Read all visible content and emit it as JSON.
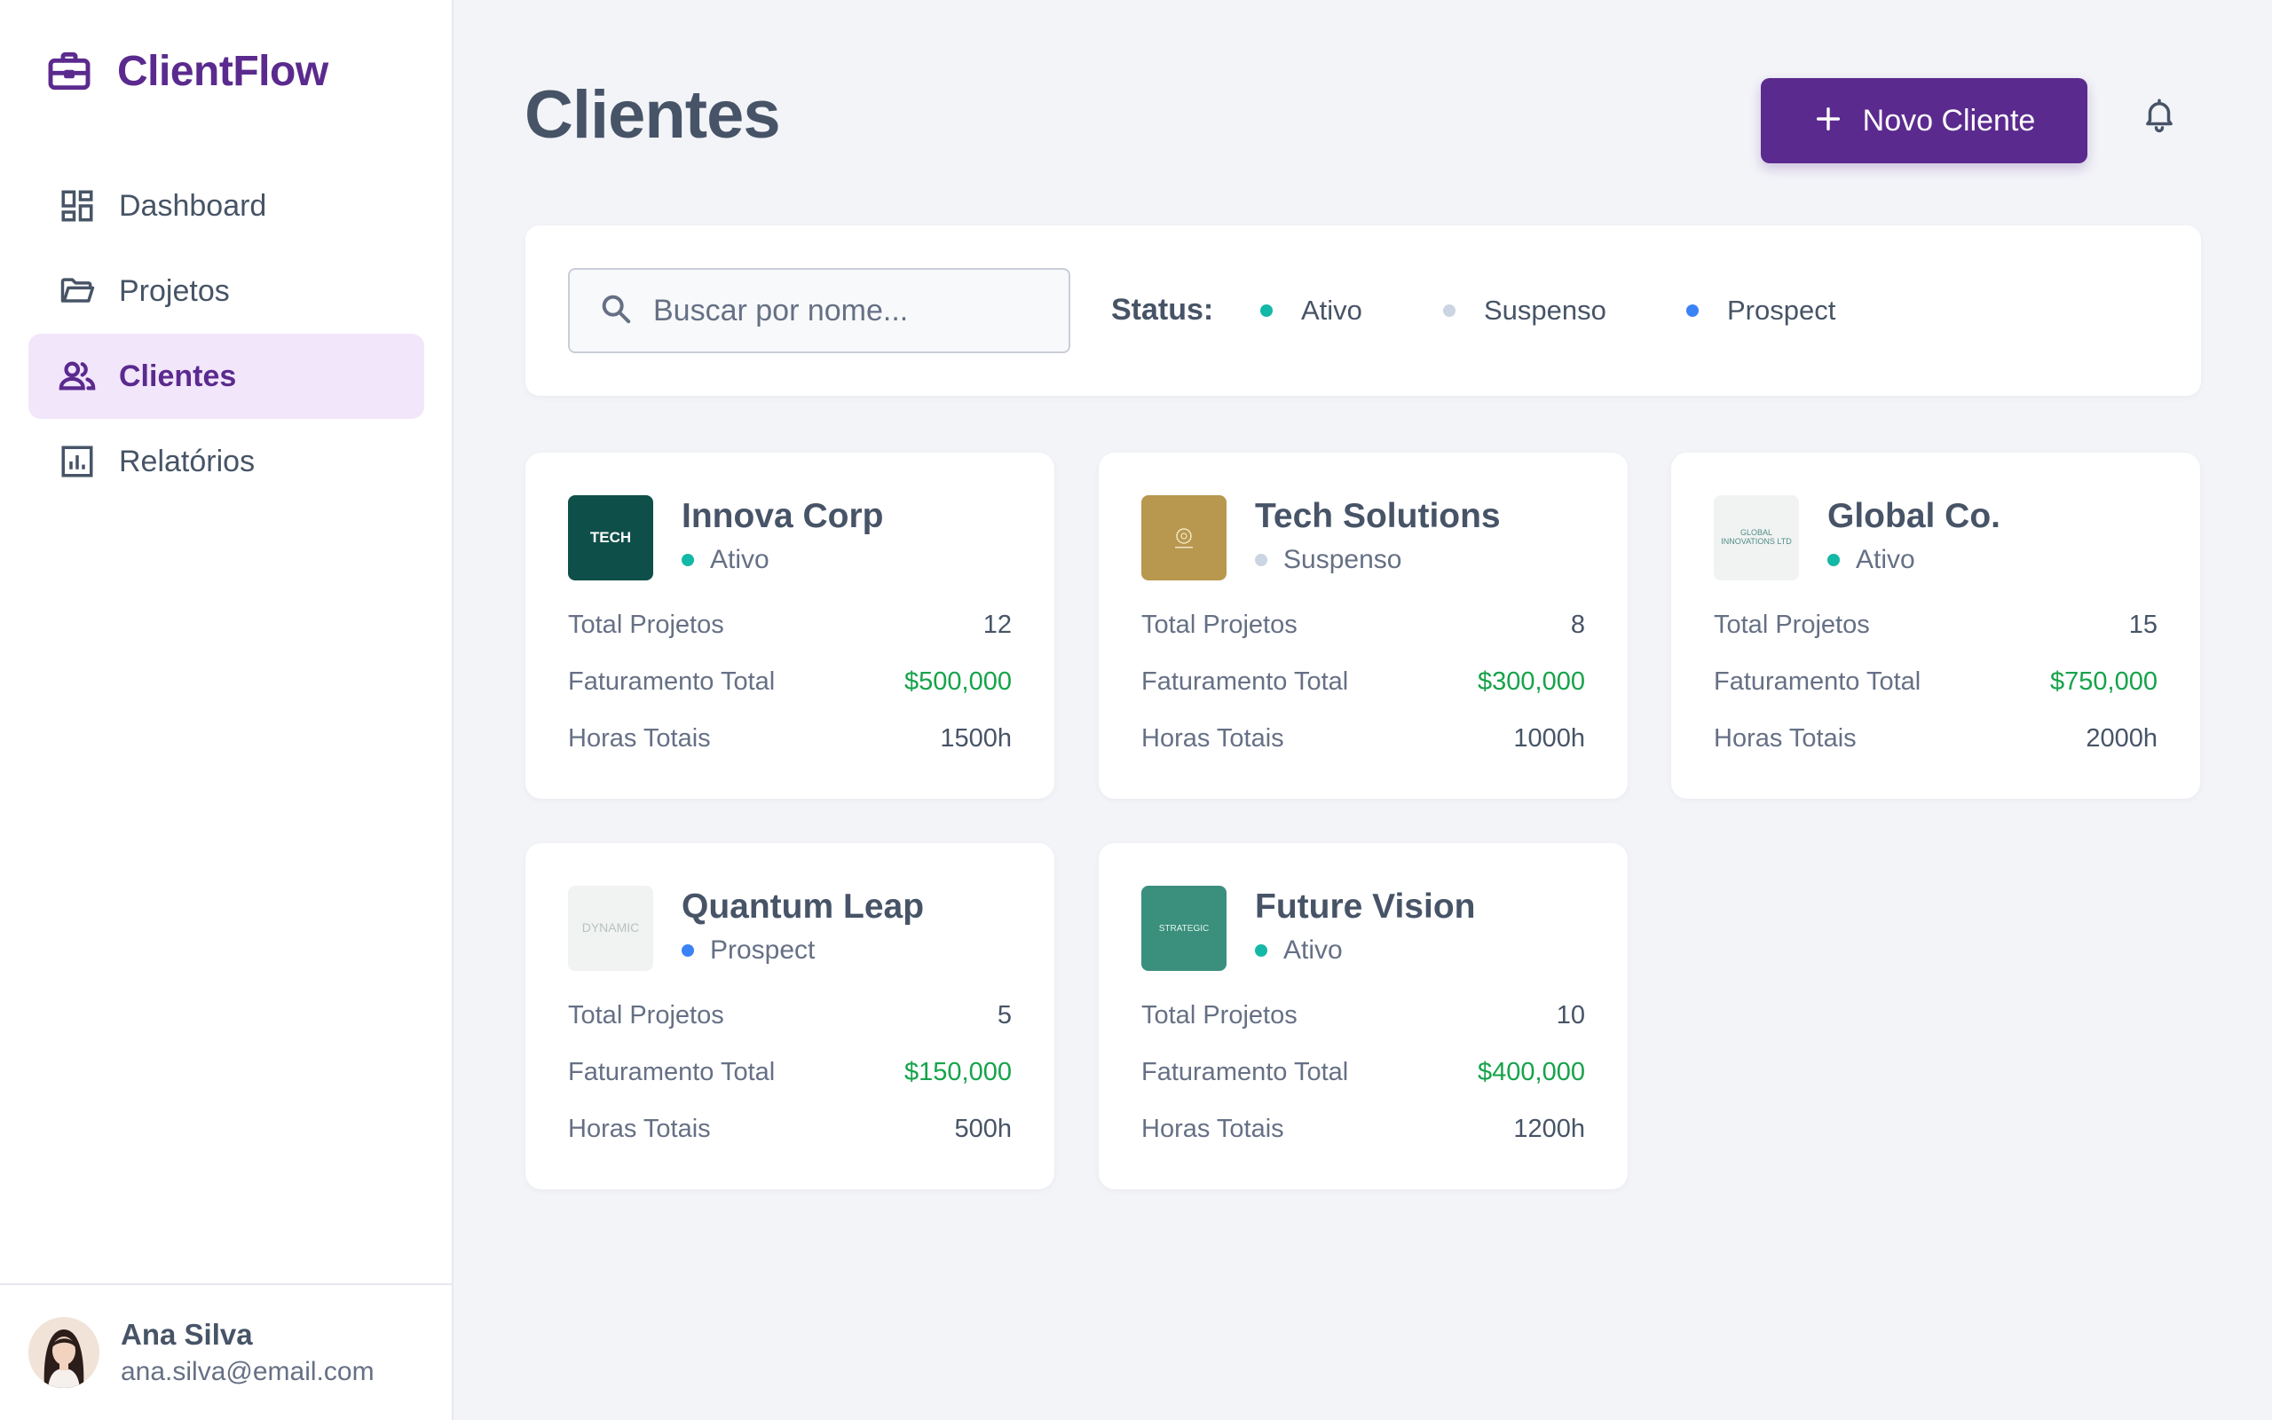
{
  "app": {
    "name": "ClientFlow"
  },
  "nav": [
    {
      "label": "Dashboard",
      "icon": "dashboard-icon",
      "active": false
    },
    {
      "label": "Projetos",
      "icon": "folder-icon",
      "active": false
    },
    {
      "label": "Clientes",
      "icon": "users-icon",
      "active": true
    },
    {
      "label": "Relatórios",
      "icon": "chart-icon",
      "active": false
    }
  ],
  "user": {
    "name": "Ana Silva",
    "email": "ana.silva@email.com"
  },
  "header": {
    "title": "Clientes",
    "new_button": "Novo Cliente"
  },
  "filters": {
    "search_placeholder": "Buscar por nome...",
    "status_label": "Status:",
    "options": [
      {
        "label": "Ativo",
        "color": "#14b8a6"
      },
      {
        "label": "Suspenso",
        "color": "#cbd5e1"
      },
      {
        "label": "Prospect",
        "color": "#3b82f6"
      }
    ]
  },
  "labels": {
    "projects": "Total Projetos",
    "revenue": "Faturamento Total",
    "hours": "Horas Totais"
  },
  "clients": [
    {
      "name": "Innova Corp",
      "status": "Ativo",
      "status_color": "#14b8a6",
      "projects": "12",
      "revenue": "$500,000",
      "hours": "1500h",
      "logo_text": "TECH",
      "logo_bg": "#0f4f4a",
      "logo_fg": "#ffffff"
    },
    {
      "name": "Tech Solutions",
      "status": "Suspenso",
      "status_color": "#cbd5e1",
      "projects": "8",
      "revenue": "$300,000",
      "hours": "1000h",
      "logo_text": "",
      "logo_bg": "#b8974f",
      "logo_fg": "#f3e6c4"
    },
    {
      "name": "Global Co.",
      "status": "Ativo",
      "status_color": "#14b8a6",
      "projects": "15",
      "revenue": "$750,000",
      "hours": "2000h",
      "logo_text": "GLOBAL\nINNOVATIONS LTD",
      "logo_bg": "#f1f2f2",
      "logo_fg": "#4f8f86"
    },
    {
      "name": "Quantum Leap",
      "status": "Prospect",
      "status_color": "#3b82f6",
      "projects": "5",
      "revenue": "$150,000",
      "hours": "500h",
      "logo_text": "DYNAMIC",
      "logo_bg": "#f1f2f2",
      "logo_fg": "#b9c3c2"
    },
    {
      "name": "Future Vision",
      "status": "Ativo",
      "status_color": "#14b8a6",
      "projects": "10",
      "revenue": "$400,000",
      "hours": "1200h",
      "logo_text": "STRATEGIC",
      "logo_bg": "#3a8f7d",
      "logo_fg": "#e6f4f0"
    }
  ]
}
